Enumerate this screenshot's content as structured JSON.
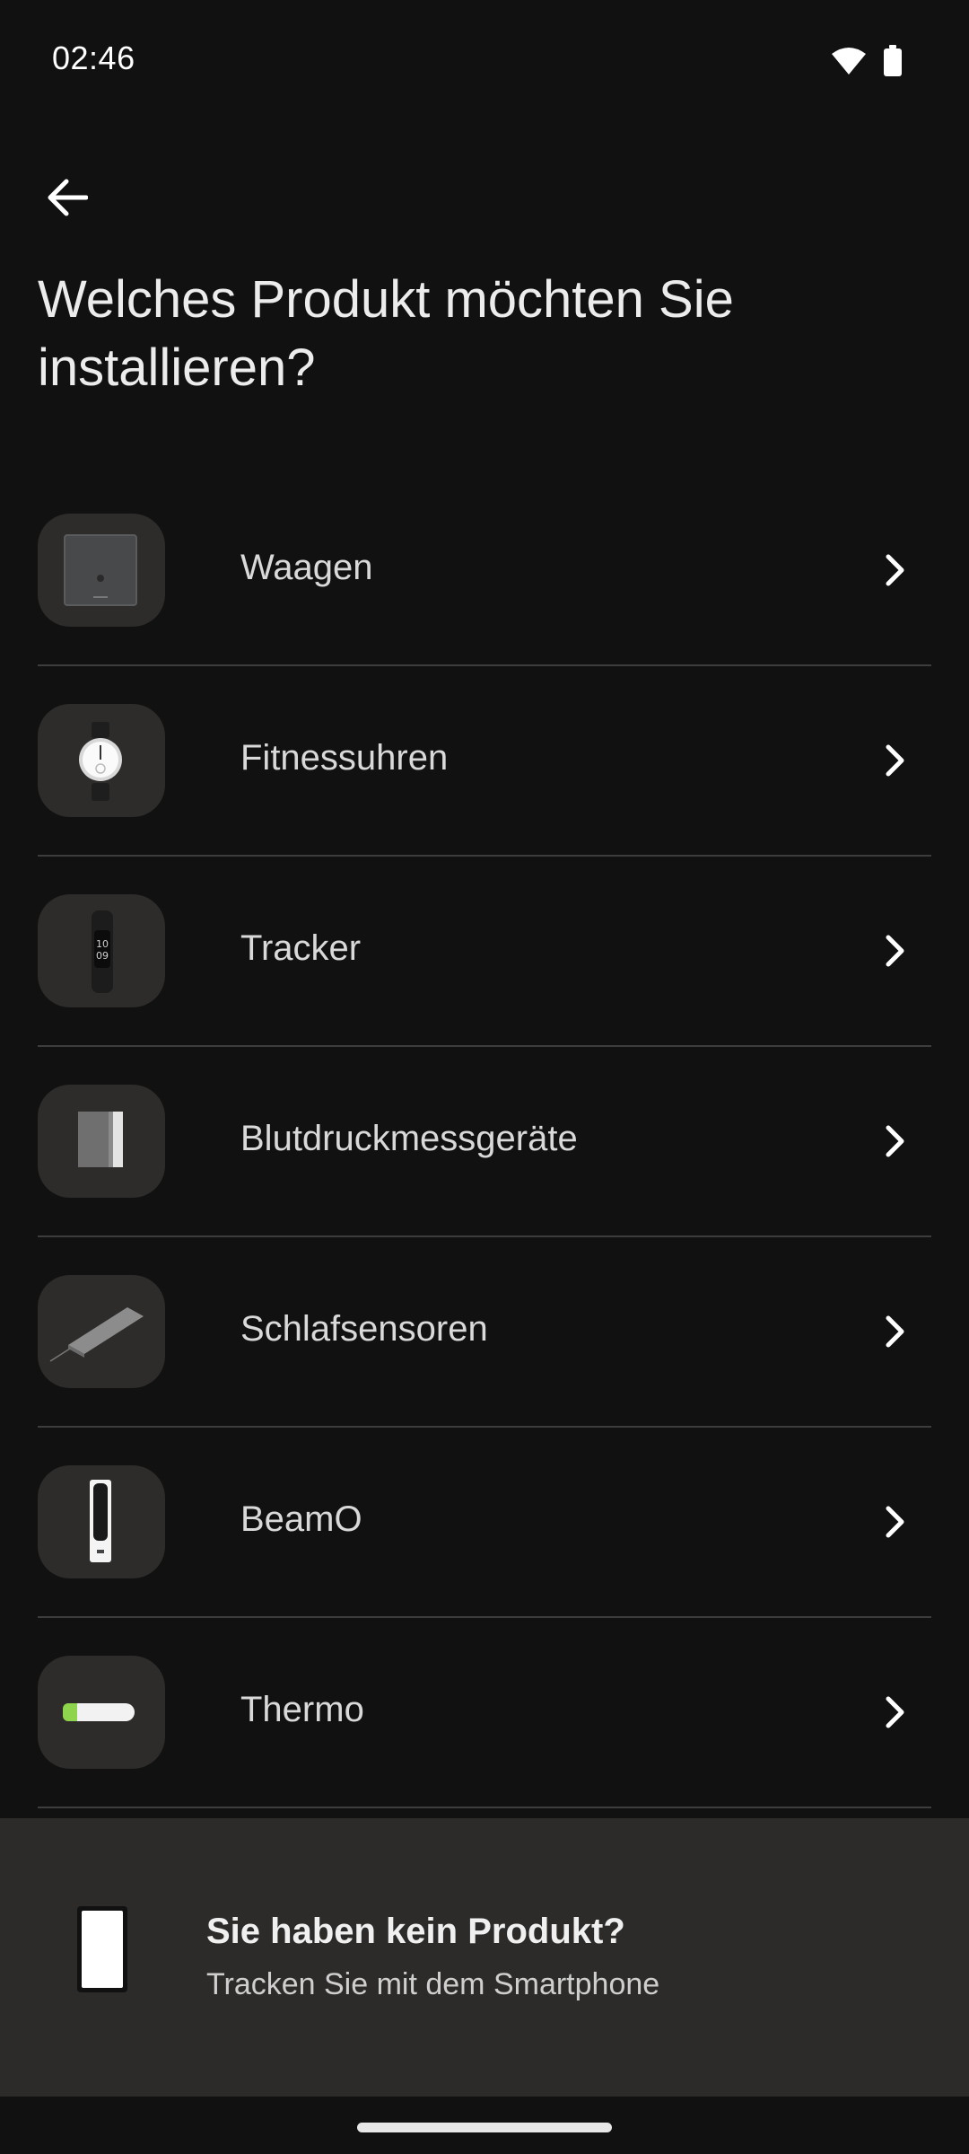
{
  "status": {
    "time": "02:46"
  },
  "header": {
    "title": "Welches Produkt möchten Sie installieren?"
  },
  "products": [
    {
      "label": "Waagen",
      "icon": "scale-icon"
    },
    {
      "label": "Fitnessuhren",
      "icon": "watch-icon"
    },
    {
      "label": "Tracker",
      "icon": "tracker-icon"
    },
    {
      "label": "Blutdruckmessgeräte",
      "icon": "blood-pressure-icon"
    },
    {
      "label": "Schlafsensoren",
      "icon": "sleep-sensor-icon"
    },
    {
      "label": "BeamO",
      "icon": "beamo-icon"
    },
    {
      "label": "Thermo",
      "icon": "thermo-icon"
    }
  ],
  "no_product": {
    "title": "Sie haben kein Produkt?",
    "subtitle": "Tracken Sie mit dem Smartphone"
  },
  "colors": {
    "background": "#111111",
    "card": "#2c2b29",
    "thumb": "#2d2c2a",
    "divider": "#3d3d3d",
    "text": "#d9d9d9"
  }
}
